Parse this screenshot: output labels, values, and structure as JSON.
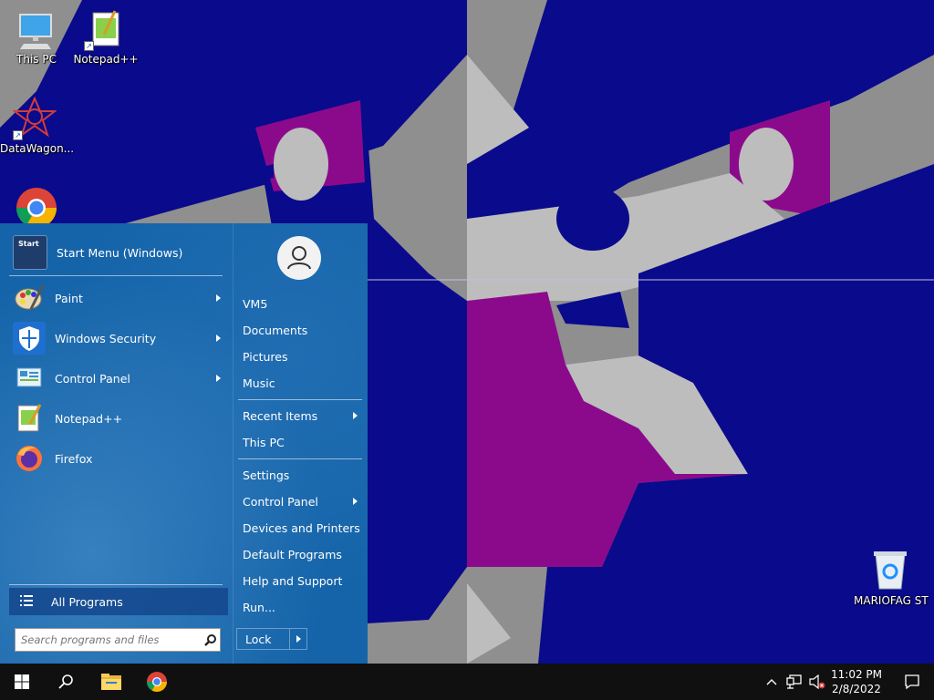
{
  "colors": {
    "wallpaper_blue": "#0a0a8c",
    "wallpaper_magenta": "#8b0a8b",
    "wallpaper_grey": "#bdbdbd",
    "start_bg": "#1564a9",
    "taskbar": "#101010"
  },
  "desktop": {
    "icons": [
      {
        "name": "pc-icon",
        "label": "This PC"
      },
      {
        "name": "notepadpp-icon",
        "label": "Notepad++"
      },
      {
        "name": "datawagon-icon",
        "label": "DataWagon..."
      },
      {
        "name": "chrome-icon",
        "label": ""
      },
      {
        "name": "recycle-bin-icon",
        "label": "MARIOFAG ST"
      }
    ]
  },
  "start_menu": {
    "pinned_header": {
      "label": "Start Menu (Windows)",
      "icon_text": "Start"
    },
    "programs": [
      {
        "label": "Paint",
        "icon": "paint-icon",
        "has_submenu": true
      },
      {
        "label": "Windows Security",
        "icon": "windows-security-icon",
        "has_submenu": true
      },
      {
        "label": "Control Panel",
        "icon": "control-panel-icon",
        "has_submenu": true
      },
      {
        "label": "Notepad++",
        "icon": "notepadpp-icon",
        "has_submenu": false
      },
      {
        "label": "Firefox",
        "icon": "firefox-icon",
        "has_submenu": false
      }
    ],
    "all_programs_label": "All Programs",
    "search_placeholder": "Search programs and files",
    "user_avatar_icon": "user-icon",
    "right_items": [
      {
        "label": "VM5"
      },
      {
        "label": "Documents"
      },
      {
        "label": "Pictures"
      },
      {
        "label": "Music"
      },
      {
        "label": "Recent Items",
        "has_submenu": true
      },
      {
        "label": "This PC"
      },
      {
        "label": "Settings"
      },
      {
        "label": "Control Panel",
        "has_submenu": true
      },
      {
        "label": "Devices and Printers"
      },
      {
        "label": "Default Programs"
      },
      {
        "label": "Help and Support"
      },
      {
        "label": "Run..."
      }
    ],
    "lock_label": "Lock"
  },
  "taskbar": {
    "start_icon": "windows-logo-icon",
    "search_icon": "search-icon",
    "pinned": [
      "file-explorer-icon",
      "chrome-icon"
    ],
    "tray": [
      "chevron-up-icon",
      "network-icon",
      "volume-muted-icon"
    ],
    "time": "11:02 PM",
    "date": "2/8/2022",
    "notification_icon": "notification-icon"
  }
}
